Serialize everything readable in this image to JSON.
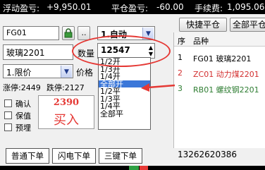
{
  "topbar": {
    "float_label": "浮动盈亏:",
    "float_value": "+9,950.01",
    "close_label": "平仓盈亏:",
    "close_value": "-60.00",
    "fee_label": "手续费:",
    "fee_value": "1,095.06"
  },
  "top_buttons": {
    "quick_close": "快捷平仓",
    "close_all": "全部平仓"
  },
  "order_form": {
    "account": "FG01",
    "lock_btn": "",
    "more_btn": "..",
    "mode": "1.自动",
    "contract": "玻璃2201",
    "qty_label": "数量",
    "qty_value": "12547",
    "price_type": "1.限价",
    "price_label": "价格",
    "up_stop": "涨停:2449",
    "down_stop": "跌停:2127"
  },
  "dropdown": {
    "options": [
      "1/2开",
      "1/3开",
      "1/4开",
      "全部开",
      "1/2平",
      "1/3平",
      "1/4平",
      "全部平"
    ],
    "selected_index": 3
  },
  "checkboxes": [
    {
      "label": "确认"
    },
    {
      "label": "保值"
    },
    {
      "label": "预埋"
    }
  ],
  "buy": {
    "price": "2390",
    "label": "买入"
  },
  "tabs": [
    "普通下单",
    "闪电下单",
    "三键下单"
  ],
  "grid": {
    "headers": [
      "序",
      "品种"
    ],
    "rows": [
      {
        "no": "1",
        "name": "FG01 玻璃2201",
        "color": "#000000"
      },
      {
        "no": "2",
        "name": "ZC01 动力煤2201",
        "color": "#d32f2f"
      },
      {
        "no": "3",
        "name": "RB01 螺纹钢2201",
        "color": "#2e7d32"
      }
    ]
  },
  "phone": "13262620386",
  "colors": {
    "accent_red": "#e53935",
    "select_blue": "#3b77d9"
  }
}
